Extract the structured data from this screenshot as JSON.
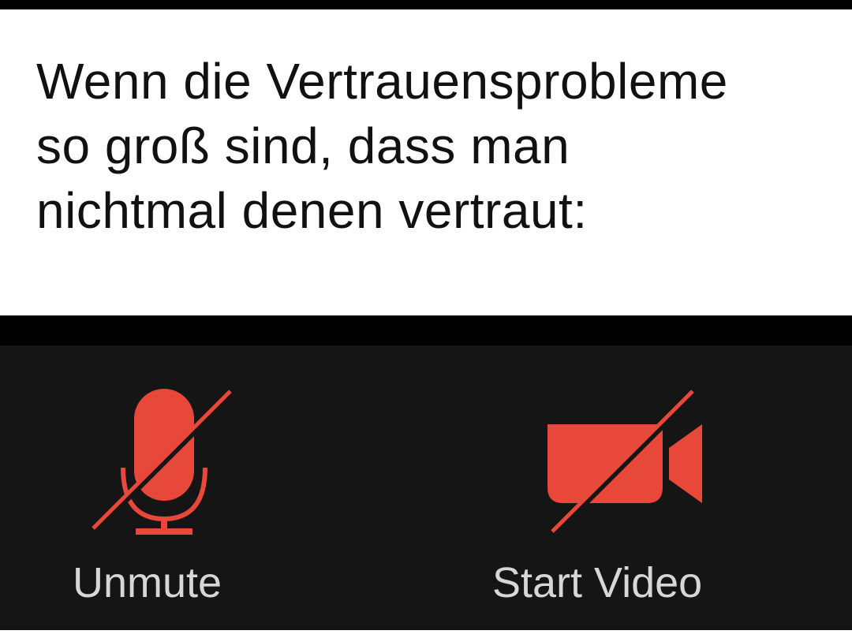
{
  "caption": {
    "lines": [
      "Wenn die Vertrauensprobleme",
      "so groß sind, dass man",
      "nichtmal denen vertraut:"
    ]
  },
  "toolbar": {
    "unmute": {
      "label": "Unmute",
      "icon": "muted-microphone-icon"
    },
    "video": {
      "label": "Start Video",
      "icon": "video-off-camera-icon"
    }
  },
  "colors": {
    "icon_red": "#e8483a",
    "toolbar_bg": "#151515",
    "label_text": "#d7d7d7"
  }
}
